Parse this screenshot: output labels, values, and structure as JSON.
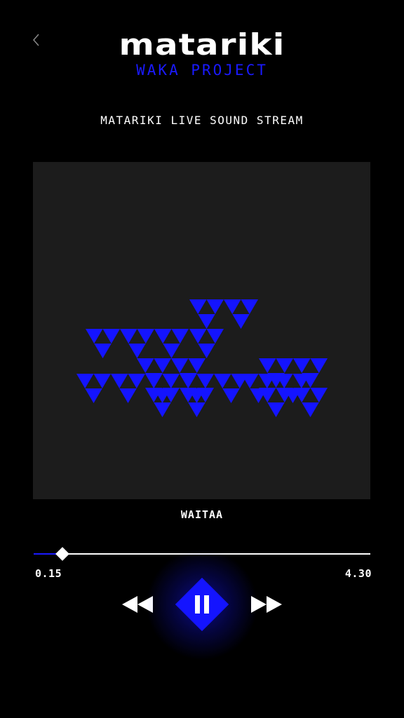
{
  "header": {
    "back_icon": "chevron-left-icon",
    "logo_title": "MATARIKI",
    "logo_subtitle": "WAKA PROJECT"
  },
  "stream": {
    "title": "MATARIKI LIVE SOUND STREAM"
  },
  "artwork": {
    "background": "#1c1c1c",
    "accent": "#1414ff"
  },
  "player": {
    "track_title": "WAITAA",
    "current_time": "0.15",
    "total_time": "4.30",
    "progress_fraction": 0.085,
    "state": "playing",
    "controls": {
      "rewind_icon": "rewind-icon",
      "pause_icon": "pause-icon",
      "forward_icon": "fast-forward-icon"
    }
  },
  "colors": {
    "background": "#000000",
    "accent_blue": "#1414ff",
    "text": "#ffffff"
  }
}
